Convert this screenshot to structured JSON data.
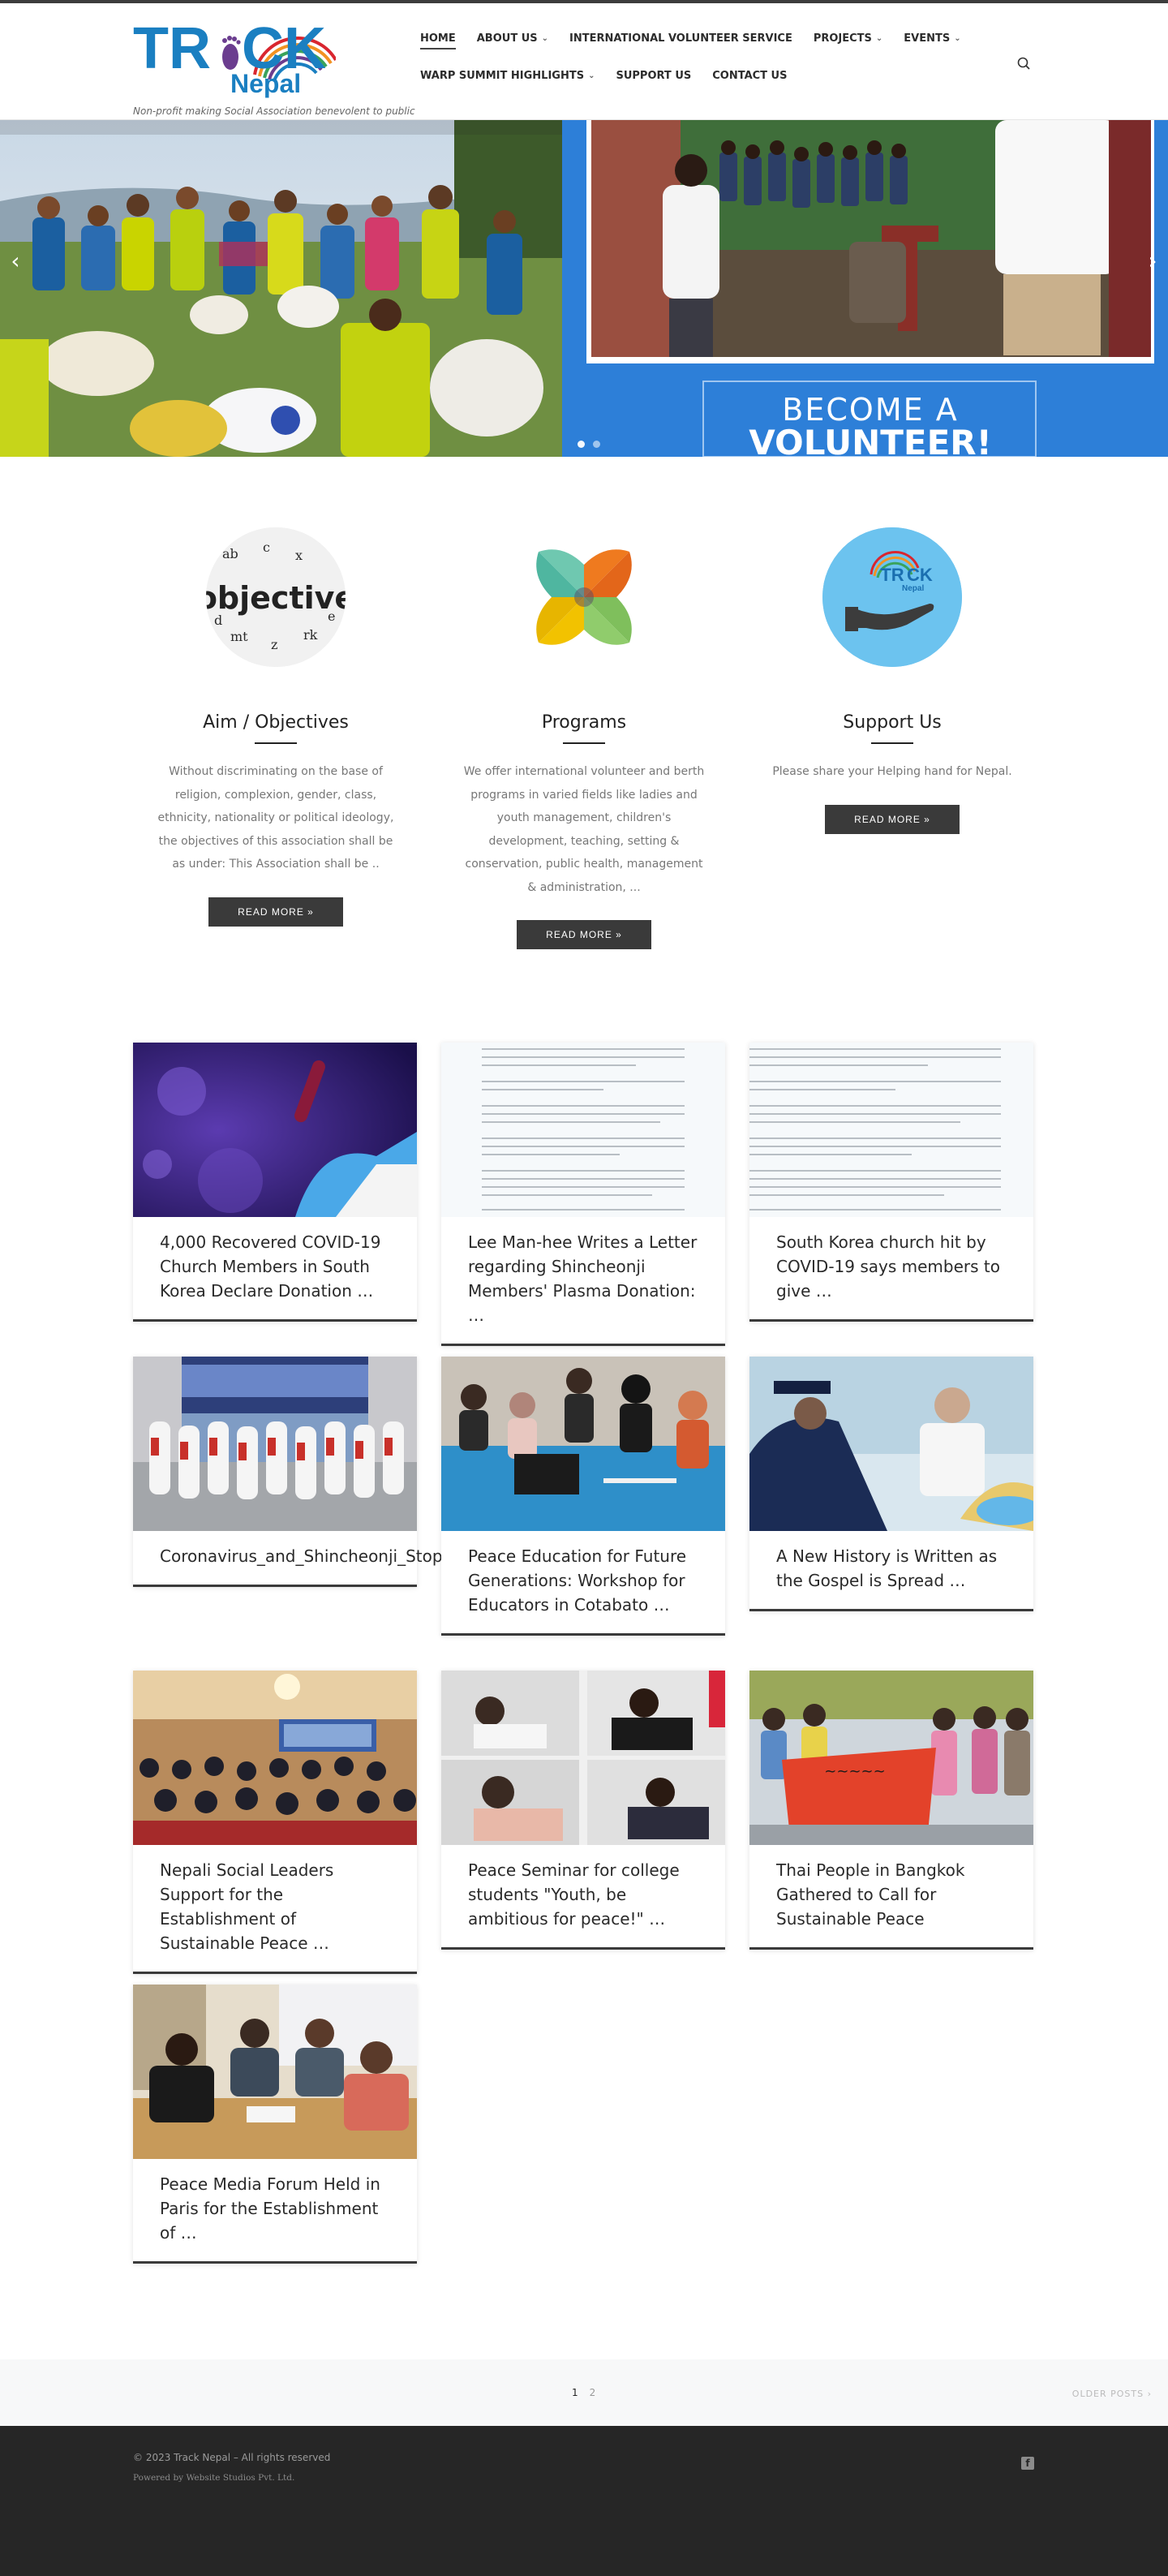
{
  "brand": {
    "logo_text_main": "TR",
    "logo_text_end": "CK",
    "logo_text_sub": "Nepal",
    "tagline": "Non-profit making Social Association benevolent to public",
    "colors": {
      "blue": "#1a7fc1",
      "purple": "#6b3d8f",
      "orange": "#f29222",
      "red": "#d9262f",
      "green": "#3aa35b"
    }
  },
  "nav": {
    "row1": [
      {
        "label": "HOME",
        "dropdown": false,
        "active": true
      },
      {
        "label": "ABOUT US",
        "dropdown": true,
        "active": false
      },
      {
        "label": "INTERNATIONAL VOLUNTEER SERVICE",
        "dropdown": false,
        "active": false
      },
      {
        "label": "PROJECTS",
        "dropdown": true,
        "active": false
      },
      {
        "label": "EVENTS",
        "dropdown": true,
        "active": false
      }
    ],
    "row2": [
      {
        "label": "WARP SUMMIT HIGHLIGHTS",
        "dropdown": true,
        "active": false
      },
      {
        "label": "SUPPORT US",
        "dropdown": false,
        "active": false
      },
      {
        "label": "CONTACT US",
        "dropdown": false,
        "active": false
      }
    ],
    "search_icon": "search-icon"
  },
  "slider": {
    "banner_line1": "BECOME A",
    "banner_line2": "VOLUNTEER!",
    "banner_color": "#2d7fd8",
    "prev_icon": "chevron-left-icon",
    "next_icon": "chevron-right-icon",
    "slide_count": 2,
    "active_slide": 1
  },
  "features": [
    {
      "title": "Aim / Objectives",
      "image_word": "objective",
      "text": "Without discriminating on the base of religion, complexion, gender, class, ethnicity, nationality or political ideology, the objectives of this association shall be as under: This Association shall be ..",
      "button": "READ MORE »"
    },
    {
      "title": "Programs",
      "text": "We offer international volunteer and berth programs in varied fields like ladies and youth management, children's development, teaching, setting & conservation, public health, management & administration, ...",
      "button": "READ MORE »"
    },
    {
      "title": "Support Us",
      "text": "Please share your Helping hand for Nepal.",
      "button": "READ MORE »"
    }
  ],
  "posts": [
    {
      "title": "4,000 Recovered COVID-19 Church Members in South Korea Declare Donation …"
    },
    {
      "title": "Lee Man-hee Writes a Letter regarding Shincheonji Members' Plasma Donation: …"
    },
    {
      "title": "South Korea church hit by COVID-19 says members to give …"
    },
    {
      "title": "Coronavirus_and_Shincheonji_Stopping_the_Witch_Hunt"
    },
    {
      "title": "Peace Education for Future Generations: Workshop for Educators in Cotabato …"
    },
    {
      "title": "A New History is Written as the Gospel is Spread …"
    },
    {
      "title": "Nepali Social Leaders Support for the Establishment of Sustainable Peace …"
    },
    {
      "title": "Peace Seminar for college students \"Youth, be ambitious for peace!\" …"
    },
    {
      "title": "Thai People in Bangkok Gathered to Call for Sustainable Peace"
    },
    {
      "title": "Peace Media Forum Held in Paris for the Establishment of …"
    }
  ],
  "pagination": {
    "pages": [
      "1",
      "2"
    ],
    "current": "1",
    "older": "OLDER POSTS ›"
  },
  "footer": {
    "copyright": "© 2023 Track Nepal – All rights reserved",
    "powered": "Powered by Website Studios Pvt. Ltd.",
    "social_icon": "facebook-icon",
    "social_label": "f"
  }
}
